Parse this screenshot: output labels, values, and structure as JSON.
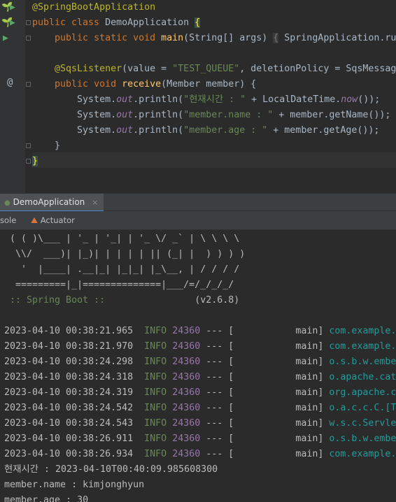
{
  "editor": {
    "lines": [
      [
        {
          "t": "@SpringBootApplication",
          "c": "ann"
        }
      ],
      [
        {
          "t": "public class ",
          "c": "kw"
        },
        {
          "t": "DemoApplication ",
          "c": ""
        },
        {
          "t": "{",
          "c": "braceHL"
        }
      ],
      [
        {
          "t": "    "
        },
        {
          "t": "public static void ",
          "c": "kw"
        },
        {
          "t": "main",
          "c": "fn"
        },
        {
          "t": "(String[] args) "
        },
        {
          "t": "{",
          "c": "hint"
        },
        {
          "t": " SpringApplication.ru"
        }
      ],
      [],
      [
        {
          "t": "    "
        },
        {
          "t": "@SqsListener",
          "c": "ann"
        },
        {
          "t": "(value = "
        },
        {
          "t": "\"TEST_QUEUE\"",
          "c": "str"
        },
        {
          "t": ", deletionPolicy = SqsMessag"
        }
      ],
      [
        {
          "t": "    "
        },
        {
          "t": "public void ",
          "c": "kw"
        },
        {
          "t": "receive",
          "c": "fn"
        },
        {
          "t": "(Member member) {"
        }
      ],
      [
        {
          "t": "        System."
        },
        {
          "t": "out",
          "c": "fld"
        },
        {
          "t": ".println("
        },
        {
          "t": "\"현재시간 : \"",
          "c": "str"
        },
        {
          "t": " + LocalDateTime."
        },
        {
          "t": "now",
          "c": "fld"
        },
        {
          "t": "());"
        }
      ],
      [
        {
          "t": "        System."
        },
        {
          "t": "out",
          "c": "fld"
        },
        {
          "t": ".println("
        },
        {
          "t": "\"member.name : \"",
          "c": "str"
        },
        {
          "t": " + member.getName());"
        }
      ],
      [
        {
          "t": "        System."
        },
        {
          "t": "out",
          "c": "fld"
        },
        {
          "t": ".println("
        },
        {
          "t": "\"member.age : \"",
          "c": "str"
        },
        {
          "t": " + member.getAge());"
        }
      ],
      [
        {
          "t": "    }"
        }
      ],
      [
        {
          "t": "}",
          "c": "braceHL"
        }
      ]
    ]
  },
  "run_tab": {
    "label": "DemoApplication",
    "close": "×"
  },
  "subtabs": {
    "console": "sole",
    "actuator": "Actuator"
  },
  "banner": [
    " ( ( )\\___ | '_ | '_| | '_ \\/ _` | \\ \\ \\ \\",
    "  \\\\/  ___)| |_)| | | | | || (_| |  ) ) ) )",
    "   '  |____| .__|_| |_|_| |_\\__, | / / / /",
    "  =========|_|==============|___/=/_/_/_/"
  ],
  "spring_line": {
    "label": " :: Spring Boot :: ",
    "version": "               (v2.6.8)"
  },
  "logs": [
    {
      "ts": "2023-04-10 00:38:21.965",
      "level": "INFO",
      "pid": "24360",
      "sep": " --- [",
      "thread": "           main]",
      "logger": " com.example."
    },
    {
      "ts": "2023-04-10 00:38:21.970",
      "level": "INFO",
      "pid": "24360",
      "sep": " --- [",
      "thread": "           main]",
      "logger": " com.example."
    },
    {
      "ts": "2023-04-10 00:38:24.298",
      "level": "INFO",
      "pid": "24360",
      "sep": " --- [",
      "thread": "           main]",
      "logger": " o.s.b.w.embe"
    },
    {
      "ts": "2023-04-10 00:38:24.318",
      "level": "INFO",
      "pid": "24360",
      "sep": " --- [",
      "thread": "           main]",
      "logger": " o.apache.cat"
    },
    {
      "ts": "2023-04-10 00:38:24.319",
      "level": "INFO",
      "pid": "24360",
      "sep": " --- [",
      "thread": "           main]",
      "logger": " org.apache.c"
    },
    {
      "ts": "2023-04-10 00:38:24.542",
      "level": "INFO",
      "pid": "24360",
      "sep": " --- [",
      "thread": "           main]",
      "logger": " o.a.c.c.C.[T"
    },
    {
      "ts": "2023-04-10 00:38:24.543",
      "level": "INFO",
      "pid": "24360",
      "sep": " --- [",
      "thread": "           main]",
      "logger": " w.s.c.Servle"
    },
    {
      "ts": "2023-04-10 00:38:26.911",
      "level": "INFO",
      "pid": "24360",
      "sep": " --- [",
      "thread": "           main]",
      "logger": " o.s.b.w.embe"
    },
    {
      "ts": "2023-04-10 00:38:26.934",
      "level": "INFO",
      "pid": "24360",
      "sep": " --- [",
      "thread": "           main]",
      "logger": " com.example."
    }
  ],
  "output": [
    "현재시간 : 2023-04-10T00:40:09.985608300",
    "member.name : kimjonghyun",
    "member.age : 30"
  ]
}
